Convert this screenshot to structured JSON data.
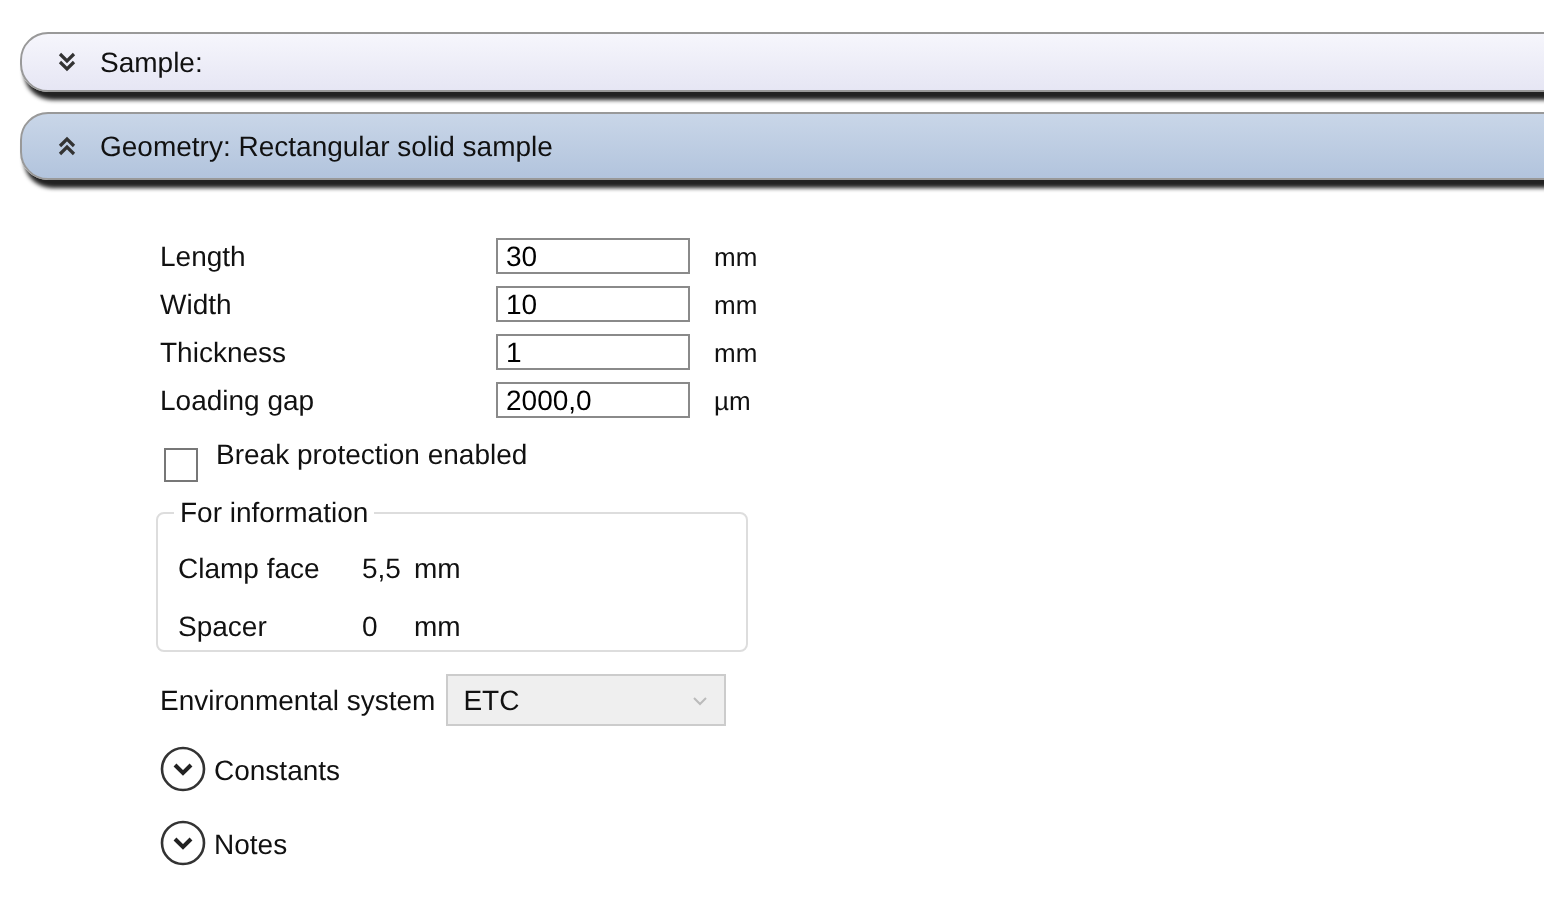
{
  "sections": [
    {
      "title": "Sample:",
      "expanded": false
    },
    {
      "title": "Geometry: Rectangular solid sample",
      "expanded": true
    }
  ],
  "fields": [
    {
      "label": "Length",
      "value": "30",
      "unit": "mm"
    },
    {
      "label": "Width",
      "value": "10",
      "unit": "mm"
    },
    {
      "label": "Thickness",
      "value": "1",
      "unit": "mm"
    },
    {
      "label": "Loading gap",
      "value": "2000,0",
      "unit": "µm"
    }
  ],
  "break_protection": {
    "label": "Break protection enabled",
    "checked": false
  },
  "information": {
    "title": "For information",
    "rows": [
      {
        "label": "Clamp face",
        "value": "5,5",
        "unit": "mm"
      },
      {
        "label": "Spacer",
        "value": "0",
        "unit": "mm"
      }
    ]
  },
  "environmental_system": {
    "label": "Environmental system",
    "value": "ETC",
    "disabled": true
  },
  "expanders": [
    {
      "label": "Constants",
      "expanded": false
    },
    {
      "label": "Notes",
      "expanded": false
    }
  ]
}
